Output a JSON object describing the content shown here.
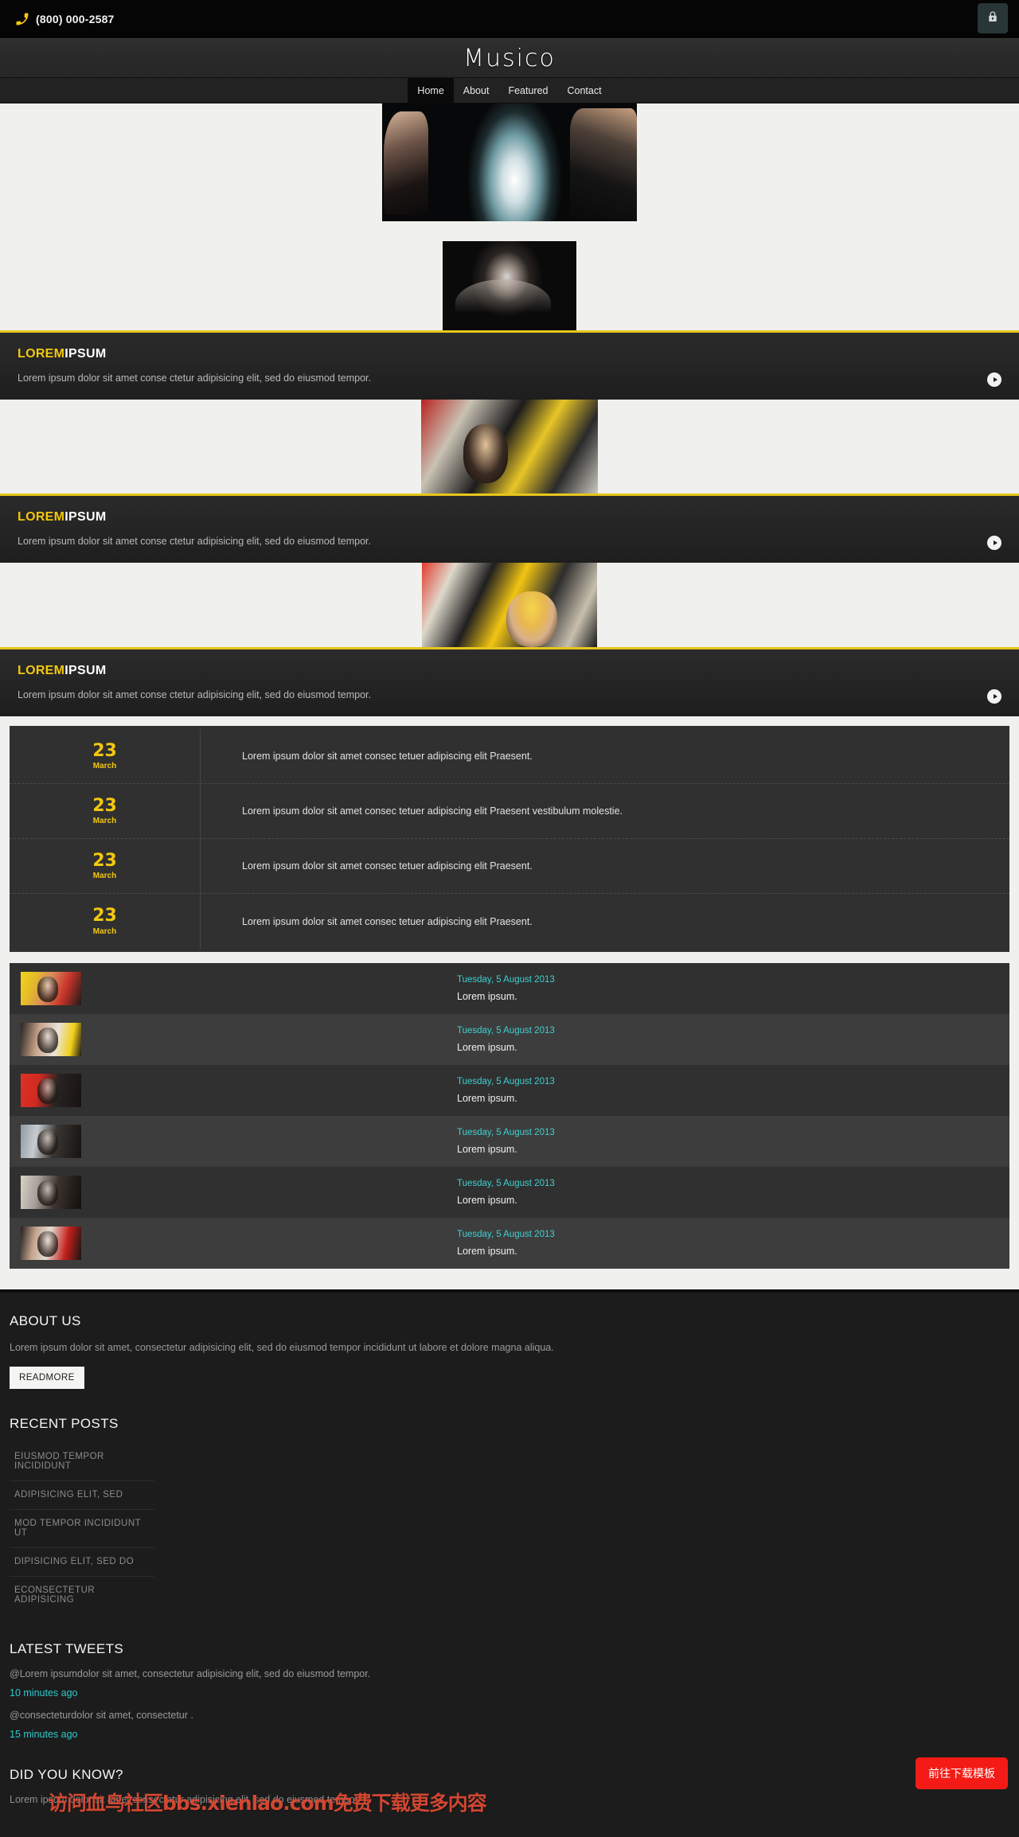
{
  "topbar": {
    "phone_icon": "phone-icon",
    "phone": "(800) 000-2587",
    "lock_icon": "🔒"
  },
  "header": {
    "logo": "Musico"
  },
  "nav": {
    "items": [
      {
        "label": "Home",
        "active": true
      },
      {
        "label": "About",
        "active": false
      },
      {
        "label": "Featured",
        "active": false
      },
      {
        "label": "Contact",
        "active": false
      }
    ]
  },
  "banners": [
    {
      "title_yellow": "LOREM",
      "title_white": "IPSUM",
      "desc": "Lorem ipsum dolor sit amet conse ctetur adipisicing elit, sed do eiusmod tempor.",
      "arrow_icon": "play-arrow-icon"
    },
    {
      "title_yellow": "LOREM",
      "title_white": "IPSUM",
      "desc": "Lorem ipsum dolor sit amet conse ctetur adipisicing elit, sed do eiusmod tempor.",
      "arrow_icon": "play-arrow-icon"
    },
    {
      "title_yellow": "LOREM",
      "title_white": "IPSUM",
      "desc": "Lorem ipsum dolor sit amet conse ctetur adipisicing elit, sed do eiusmod tempor.",
      "arrow_icon": "play-arrow-icon"
    }
  ],
  "events": [
    {
      "day": "23",
      "month": "March",
      "text": "Lorem ipsum dolor sit amet consec tetuer adipiscing elit Praesent."
    },
    {
      "day": "23",
      "month": "March",
      "text": "Lorem ipsum dolor sit amet consec tetuer adipiscing elit Praesent vestibulum molestie."
    },
    {
      "day": "23",
      "month": "March",
      "text": "Lorem ipsum dolor sit amet consec tetuer adipiscing elit Praesent."
    },
    {
      "day": "23",
      "month": "March",
      "text": "Lorem ipsum dolor sit amet consec tetuer adipiscing elit Praesent."
    }
  ],
  "news": [
    {
      "date": "Tuesday, 5 August 2013",
      "title": "Lorem ipsum."
    },
    {
      "date": "Tuesday, 5 August 2013",
      "title": "Lorem ipsum."
    },
    {
      "date": "Tuesday, 5 August 2013",
      "title": "Lorem ipsum."
    },
    {
      "date": "Tuesday, 5 August 2013",
      "title": "Lorem ipsum."
    },
    {
      "date": "Tuesday, 5 August 2013",
      "title": "Lorem ipsum."
    },
    {
      "date": "Tuesday, 5 August 2013",
      "title": "Lorem ipsum."
    }
  ],
  "footer": {
    "about_heading": "ABOUT US",
    "about_text": "Lorem ipsum dolor sit amet, consectetur adipisicing elit, sed do eiusmod tempor incididunt ut labore et dolore magna aliqua.",
    "readmore_label": "READMORE",
    "recent_heading": "RECENT POSTS",
    "recent_posts": [
      "EIUSMOD TEMPOR INCIDIDUNT",
      "ADIPISICING ELIT, SED",
      "MOD TEMPOR INCIDIDUNT UT",
      "DIPISICING ELIT, SED DO",
      "ECONSECTETUR ADIPISICING"
    ],
    "tweets_heading": "LATEST TWEETS",
    "tweets": [
      {
        "text": "@Lorem ipsumdolor sit amet, consectetur adipisicing elit, sed do eiusmod tempor.",
        "time": "10 minutes ago"
      },
      {
        "text": "@consecteturdolor sit amet, consectetur .",
        "time": "15 minutes ago"
      }
    ],
    "dyk_heading": "DID YOU KNOW?",
    "dyk_text": "Lorem ipsum dolor sit amet consectetur adipisicing elit, sed do eiusmod tempo"
  },
  "overlay": {
    "watermark": "访问血鸟社区bbs.xienlao.com免费下载更多内容",
    "download_button": "前往下载模板"
  },
  "colors": {
    "accent_yellow": "#f2c80f",
    "link_cyan": "#3fcfd0",
    "watermark_red": "#e04a33",
    "button_red": "#f41b16"
  }
}
